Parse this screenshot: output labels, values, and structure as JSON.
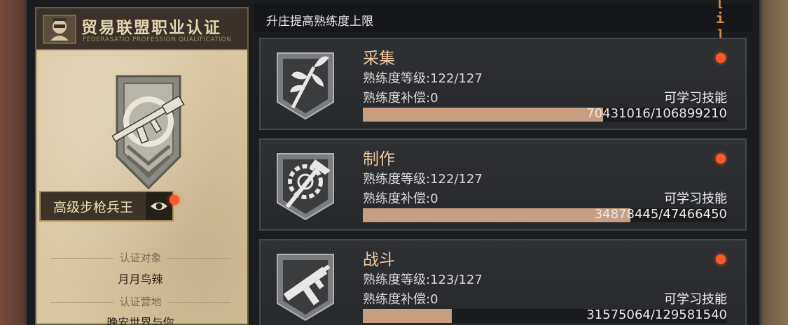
{
  "left_panel": {
    "title": "贸易联盟职业认证",
    "subtitle": "FEDERASATIO PROFESSION QUALIFICATION",
    "rank": "高级步枪兵王",
    "cert_target_label": "认证对象",
    "cert_target_value": "月月鸟辣",
    "cert_camp_label": "认证营地",
    "cert_camp_value": "晚安世界与你"
  },
  "right_panel": {
    "header_title": "升庄提高熟练度上限",
    "info_icon": "info-icon",
    "cards": [
      {
        "title": "采集",
        "level": "熟练度等级:122/127",
        "compensation": "熟练度补偿:0",
        "learn": "可学习技能",
        "progress_text": "70431016/106899210",
        "progress": 0.6589,
        "icon": "gather-plant-icon"
      },
      {
        "title": "制作",
        "level": "熟练度等级:122/127",
        "compensation": "熟练度补偿:0",
        "learn": "可学习技能",
        "progress_text": "34878445/47466450",
        "progress": 0.7348,
        "icon": "craft-hammer-gear-icon"
      },
      {
        "title": "战斗",
        "level": "熟练度等级:123/127",
        "compensation": "熟练度补偿:0",
        "learn": "可学习技能",
        "progress_text": "31575064/129581540",
        "progress": 0.2437,
        "icon": "combat-smg-icon"
      }
    ]
  },
  "colors": {
    "accent_orange": "#f0c8a0",
    "progress_fill": "#c99e80",
    "notify_dot": "#ff5a2a",
    "parchment": "#d8c7a0"
  }
}
